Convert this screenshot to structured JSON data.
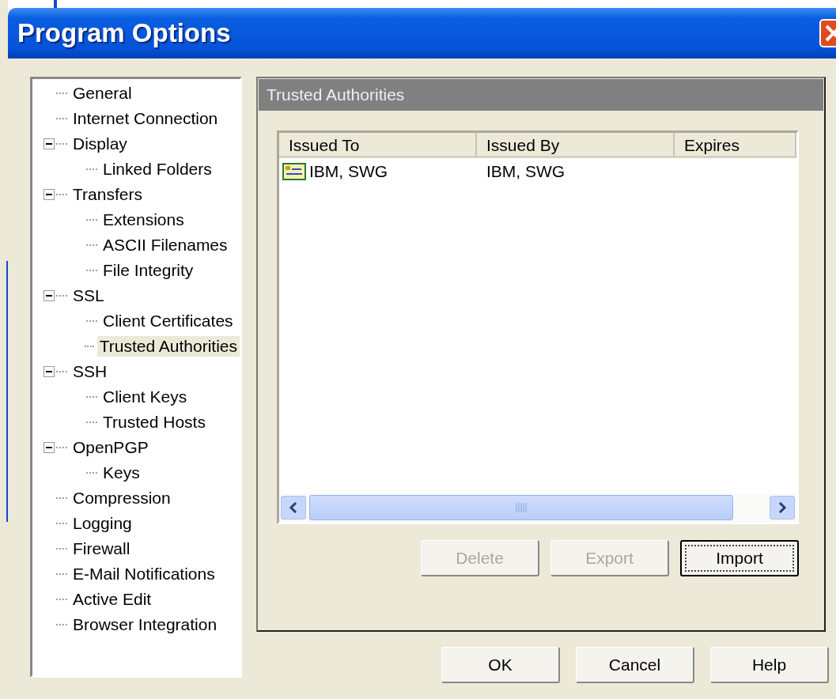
{
  "window": {
    "title": "Program Options"
  },
  "tree": [
    {
      "label": "General",
      "selected": false
    },
    {
      "label": "Internet Connection",
      "selected": false
    },
    {
      "label": "Display",
      "selected": false,
      "expanded": true,
      "children": [
        {
          "label": "Linked Folders",
          "selected": false
        }
      ]
    },
    {
      "label": "Transfers",
      "selected": false,
      "expanded": true,
      "children": [
        {
          "label": "Extensions",
          "selected": false
        },
        {
          "label": "ASCII Filenames",
          "selected": false
        },
        {
          "label": "File Integrity",
          "selected": false
        }
      ]
    },
    {
      "label": "SSL",
      "selected": false,
      "expanded": true,
      "children": [
        {
          "label": "Client Certificates",
          "selected": false
        },
        {
          "label": "Trusted Authorities",
          "selected": true
        }
      ]
    },
    {
      "label": "SSH",
      "selected": false,
      "expanded": true,
      "children": [
        {
          "label": "Client Keys",
          "selected": false
        },
        {
          "label": "Trusted Hosts",
          "selected": false
        }
      ]
    },
    {
      "label": "OpenPGP",
      "selected": false,
      "expanded": true,
      "children": [
        {
          "label": "Keys",
          "selected": false
        }
      ]
    },
    {
      "label": "Compression",
      "selected": false
    },
    {
      "label": "Logging",
      "selected": false
    },
    {
      "label": "Firewall",
      "selected": false
    },
    {
      "label": "E-Mail Notifications",
      "selected": false
    },
    {
      "label": "Active Edit",
      "selected": false
    },
    {
      "label": "Browser Integration",
      "selected": false
    }
  ],
  "panel": {
    "title": "Trusted Authorities",
    "table": {
      "columns": [
        "Issued To",
        "Issued By",
        "Expires"
      ],
      "rows": [
        {
          "issued_to": "IBM, SWG",
          "issued_by": "IBM, SWG"
        }
      ]
    },
    "buttons": [
      {
        "label": "Delete",
        "disabled": true,
        "default": false
      },
      {
        "label": "Export",
        "disabled": true,
        "default": false
      },
      {
        "label": "Import",
        "disabled": false,
        "default": true
      }
    ]
  },
  "buttons": [
    {
      "label": "OK"
    },
    {
      "label": "Cancel"
    },
    {
      "label": "Help"
    }
  ]
}
